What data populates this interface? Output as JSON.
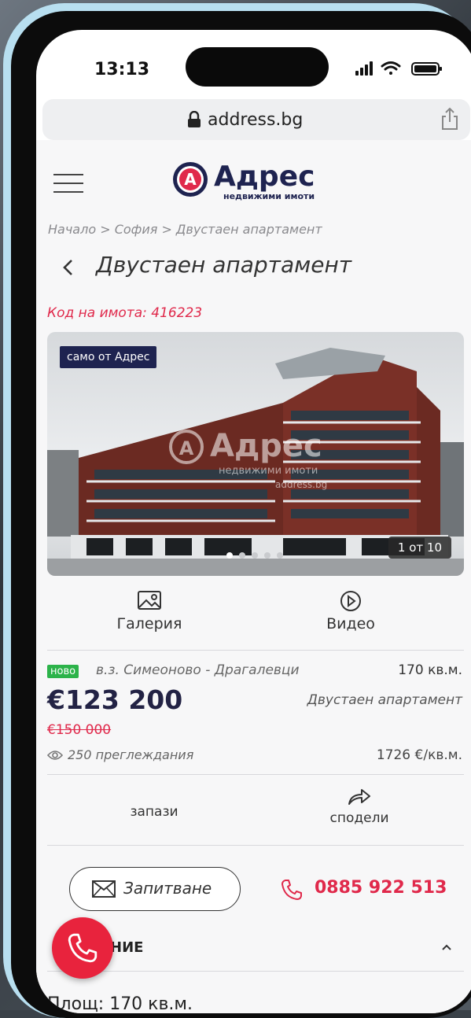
{
  "status_bar": {
    "time": "13:13"
  },
  "browser": {
    "url": "address.bg"
  },
  "header": {
    "logo_text": "Адрес",
    "logo_tagline": "недвижими имоти",
    "logo_letter": "А"
  },
  "breadcrumb": "Начало > София > Двустаен апартамент",
  "page_title": "Двустаен апартамент",
  "property_code": "Код на имота: 416223",
  "gallery": {
    "badge": "само от Адрес",
    "counter": "1 от 10",
    "watermark_text": "Адрес",
    "watermark_tagline": "недвижими имоти",
    "watermark_url": "address.bg"
  },
  "media_buttons": {
    "gallery": "Галерия",
    "video": "Видео"
  },
  "listing": {
    "new_badge": "ново",
    "location": "в.з. Симеоново - Драгалевци",
    "area": "170 кв.м.",
    "price": "€123 200",
    "old_price": "€150 000",
    "property_type": "Двустаен апартамент",
    "views": "250 преглеждания",
    "price_per_sqm": "1726 €/кв.м."
  },
  "actions": {
    "save": "запази",
    "share": "сподели"
  },
  "contact": {
    "inquiry": "Запитване",
    "phone": "0885 922 513"
  },
  "section": {
    "title_partial": "НИЕ"
  },
  "bottom_peek": "Площ: 170 кв.м.",
  "colors": {
    "brand_red": "#e0294b",
    "brand_navy": "#1e2350",
    "new_green": "#2cb34a"
  }
}
